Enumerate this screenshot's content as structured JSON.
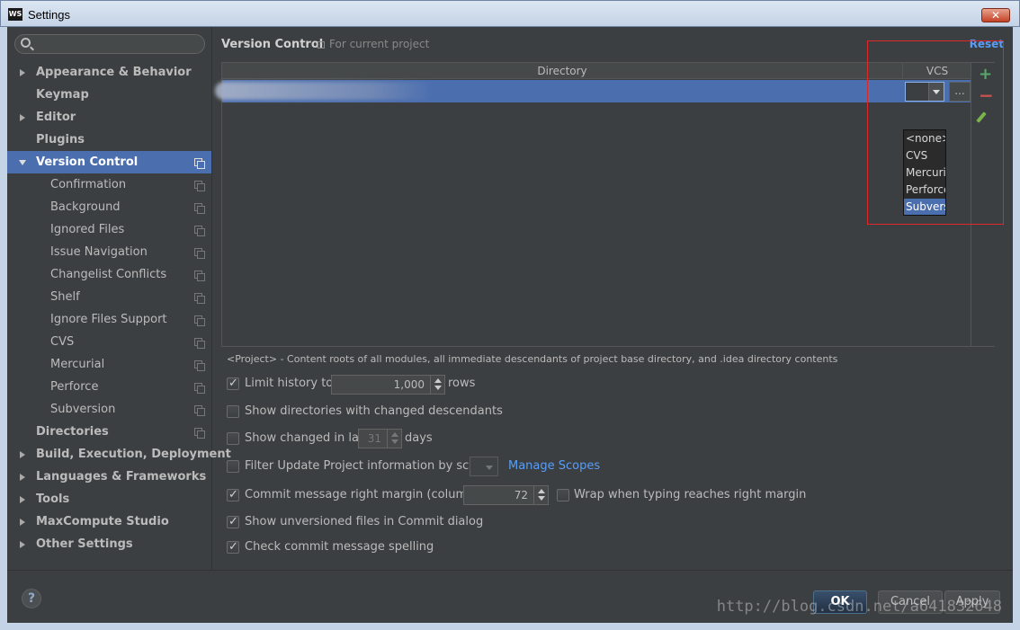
{
  "window": {
    "title": "Settings",
    "app_icon_text": "WS",
    "close_label": "✕"
  },
  "sidebar": {
    "search_placeholder": "",
    "items": [
      {
        "label": "Appearance & Behavior",
        "level": "top",
        "arrow": "collapsed"
      },
      {
        "label": "Keymap",
        "level": "top",
        "arrow": "none"
      },
      {
        "label": "Editor",
        "level": "top",
        "arrow": "collapsed"
      },
      {
        "label": "Plugins",
        "level": "top",
        "arrow": "none"
      },
      {
        "label": "Version Control",
        "level": "top",
        "arrow": "expanded",
        "selected": true
      },
      {
        "label": "Confirmation",
        "level": "sub"
      },
      {
        "label": "Background",
        "level": "sub"
      },
      {
        "label": "Ignored Files",
        "level": "sub"
      },
      {
        "label": "Issue Navigation",
        "level": "sub"
      },
      {
        "label": "Changelist Conflicts",
        "level": "sub"
      },
      {
        "label": "Shelf",
        "level": "sub"
      },
      {
        "label": "Ignore Files Support",
        "level": "sub"
      },
      {
        "label": "CVS",
        "level": "sub"
      },
      {
        "label": "Mercurial",
        "level": "sub"
      },
      {
        "label": "Perforce",
        "level": "sub"
      },
      {
        "label": "Subversion",
        "level": "sub"
      },
      {
        "label": "Directories",
        "level": "top",
        "arrow": "none"
      },
      {
        "label": "Build, Execution, Deployment",
        "level": "top",
        "arrow": "collapsed"
      },
      {
        "label": "Languages & Frameworks",
        "level": "top",
        "arrow": "collapsed"
      },
      {
        "label": "Tools",
        "level": "top",
        "arrow": "collapsed"
      },
      {
        "label": "MaxCompute Studio",
        "level": "top",
        "arrow": "collapsed"
      },
      {
        "label": "Other Settings",
        "level": "top",
        "arrow": "collapsed"
      }
    ]
  },
  "main": {
    "title": "Version Control",
    "scope": "For current project",
    "reset": "Reset",
    "table": {
      "col_directory": "Directory",
      "col_vcs": "VCS",
      "more_button": "...",
      "vcs_options": [
        "<none>",
        "CVS",
        "Mercurial",
        "Perforce",
        "Subversion"
      ],
      "highlighted_option": "Subversion"
    },
    "note": "<Project> - Content roots of all modules, all immediate descendants of project base directory, and .idea directory contents",
    "options": {
      "limit_history": {
        "label": "Limit history to:",
        "value": "1,000",
        "suffix": "rows",
        "checked": true
      },
      "show_dirs": {
        "label": "Show directories with changed descendants",
        "checked": false
      },
      "show_changed": {
        "label": "Show changed in last",
        "value": "31",
        "suffix": "days",
        "checked": false
      },
      "filter_update": {
        "label": "Filter Update Project information by scope",
        "link": "Manage Scopes",
        "checked": false
      },
      "commit_margin": {
        "label": "Commit message right margin (columns):",
        "value": "72",
        "checked": true
      },
      "wrap_typing": {
        "label": "Wrap when typing reaches right margin",
        "checked": false
      },
      "show_unversioned": {
        "label": "Show unversioned files in Commit dialog",
        "checked": true
      },
      "check_spelling": {
        "label": "Check commit message spelling",
        "checked": true
      }
    }
  },
  "footer": {
    "help": "?",
    "ok": "OK",
    "cancel": "Cancel",
    "apply": "Apply",
    "watermark": "http://blog.csdn.net/a641832648"
  }
}
